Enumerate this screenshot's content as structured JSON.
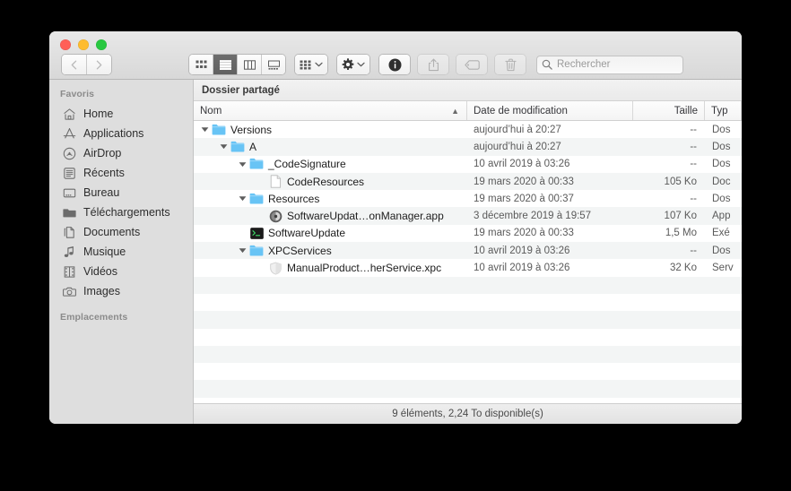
{
  "window": {
    "traffic_lights": [
      {
        "name": "close",
        "color": "#ff5f57"
      },
      {
        "name": "minimize",
        "color": "#febc2e"
      },
      {
        "name": "maximize",
        "color": "#28c840"
      }
    ]
  },
  "toolbar": {
    "nav": [
      {
        "name": "back-button",
        "icon": "chevron-left-icon",
        "enabled": false
      },
      {
        "name": "forward-button",
        "icon": "chevron-right-icon",
        "enabled": false
      }
    ],
    "view_modes": [
      {
        "name": "icon-view",
        "icon": "grid-icon",
        "active": false
      },
      {
        "name": "list-view",
        "icon": "list-icon",
        "active": true
      },
      {
        "name": "column-view",
        "icon": "columns-icon",
        "active": false
      },
      {
        "name": "gallery-view",
        "icon": "gallery-icon",
        "active": false
      }
    ],
    "arrange": {
      "name": "arrange-button",
      "icon": "grid-icon",
      "chevron": "chevron-down-icon"
    },
    "action": {
      "name": "action-button",
      "icon": "gear-icon",
      "chevron": "chevron-down-icon"
    },
    "info": {
      "name": "info-button",
      "icon": "info-icon"
    },
    "share": {
      "name": "share-button",
      "icon": "share-icon",
      "enabled": false
    },
    "tag": {
      "name": "tag-button",
      "icon": "tag-icon",
      "enabled": false
    },
    "delete": {
      "name": "delete-button",
      "icon": "trash-icon",
      "enabled": false
    }
  },
  "search": {
    "placeholder": "Rechercher",
    "value": "",
    "icon": "search-icon"
  },
  "sidebar": {
    "sections": [
      {
        "header": "Favoris",
        "items": [
          {
            "label": "Home",
            "icon": "home-icon"
          },
          {
            "label": "Applications",
            "icon": "applications-icon"
          },
          {
            "label": "AirDrop",
            "icon": "airdrop-icon"
          },
          {
            "label": "Récents",
            "icon": "recents-icon"
          },
          {
            "label": "Bureau",
            "icon": "desktop-icon"
          },
          {
            "label": "Téléchargements",
            "icon": "downloads-folder-icon"
          },
          {
            "label": "Documents",
            "icon": "documents-icon"
          },
          {
            "label": "Musique",
            "icon": "music-note-icon"
          },
          {
            "label": "Vidéos",
            "icon": "film-icon"
          },
          {
            "label": "Images",
            "icon": "camera-icon"
          }
        ]
      },
      {
        "header": "Emplacements",
        "items": []
      }
    ]
  },
  "main": {
    "path_title": "Dossier partagé",
    "columns": [
      {
        "key": "name",
        "label": "Nom",
        "sorted": true,
        "sort_caret": "▲"
      },
      {
        "key": "date",
        "label": "Date de modification",
        "sorted": false,
        "sort_caret": ""
      },
      {
        "key": "size",
        "label": "Taille",
        "sorted": false,
        "sort_caret": ""
      },
      {
        "key": "type",
        "label": "Typ",
        "sorted": false,
        "sort_caret": ""
      }
    ],
    "rows": [
      {
        "name": "Versions",
        "date": "aujourd’hui à 20:27",
        "size": "--",
        "type": "Dos",
        "indent": 0,
        "disclosure": "▼",
        "icon": "folder-icon"
      },
      {
        "name": "A",
        "date": "aujourd’hui à 20:27",
        "size": "--",
        "type": "Dos",
        "indent": 1,
        "disclosure": "▼",
        "icon": "folder-icon"
      },
      {
        "name": "_CodeSignature",
        "date": "10 avril 2019 à 03:26",
        "size": "--",
        "type": "Dos",
        "indent": 2,
        "disclosure": "▼",
        "icon": "folder-icon"
      },
      {
        "name": "CodeResources",
        "date": "19 mars 2020 à 00:33",
        "size": "105 Ko",
        "type": "Doc",
        "indent": 3,
        "disclosure": "",
        "icon": "document-icon"
      },
      {
        "name": "Resources",
        "date": "19 mars 2020 à 00:37",
        "size": "--",
        "type": "Dos",
        "indent": 2,
        "disclosure": "▼",
        "icon": "folder-icon"
      },
      {
        "name": "SoftwareUpdat…onManager.app",
        "date": "3 décembre 2019 à 19:57",
        "size": "107 Ko",
        "type": "App",
        "indent": 3,
        "disclosure": "",
        "icon": "app-bundle-icon"
      },
      {
        "name": "SoftwareUpdate",
        "date": "19 mars 2020 à 00:33",
        "size": "1,5 Mo",
        "type": "Exé",
        "indent": 2,
        "disclosure": "",
        "icon": "terminal-executable-icon"
      },
      {
        "name": "XPCServices",
        "date": "10 avril 2019 à 03:26",
        "size": "--",
        "type": "Dos",
        "indent": 2,
        "disclosure": "▼",
        "icon": "folder-icon"
      },
      {
        "name": "ManualProduct…herService.xpc",
        "date": "10 avril 2019 à 03:26",
        "size": "32 Ko",
        "type": "Serv",
        "indent": 3,
        "disclosure": "",
        "icon": "xpc-service-icon"
      }
    ],
    "empty_row_count": 7
  },
  "statusbar": {
    "text": "9 éléments, 2,24 To disponible(s)"
  },
  "colors": {
    "folder_blue": "#68c4f5",
    "row_stripe": "#f3f5f5",
    "sidebar_bg": "#dedede",
    "active_view_btn": "#696969"
  }
}
